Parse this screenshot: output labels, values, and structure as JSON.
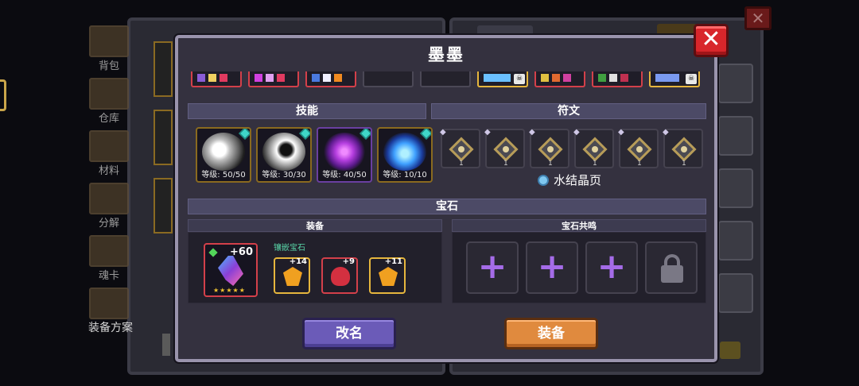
{
  "background": {
    "sidebar": [
      "背包",
      "仓库",
      "材料",
      "分解",
      "魂卡",
      "装备方案"
    ]
  },
  "modal": {
    "title": "墨墨",
    "close_glyph": "✕",
    "sections": {
      "skills": "技能",
      "runes": "符文",
      "gems": "宝石",
      "equipment": "装备",
      "resonance": "宝石共鸣"
    },
    "skills": [
      {
        "level": "等级: 50/50",
        "color": "#e8e8e8"
      },
      {
        "level": "等级: 30/30",
        "color": "#d0d0d0"
      },
      {
        "level": "等级: 40/50",
        "color": "#b63fe0"
      },
      {
        "level": "等级: 10/10",
        "color": "#3fa0ff"
      }
    ],
    "runes": [
      {
        "star": "◆",
        "num": "1"
      },
      {
        "star": "◆",
        "num": "1"
      },
      {
        "star": "◆",
        "num": "1"
      },
      {
        "star": "◆",
        "num": "1"
      },
      {
        "star": "◆",
        "num": "1"
      },
      {
        "star": "◆",
        "num": "1"
      }
    ],
    "rune_page": "水结晶页",
    "equipped_item": {
      "bonus": "+60",
      "stars": "★★★★★"
    },
    "inlay_label": "镶嵌宝石",
    "gems": [
      {
        "level": "+14",
        "color": "#f0a020"
      },
      {
        "level": "+9",
        "color": "#d33040"
      },
      {
        "level": "+11",
        "color": "#f0a020"
      }
    ],
    "resonance_plus": "+",
    "buttons": {
      "rename": "改名",
      "equip": "装备"
    }
  }
}
